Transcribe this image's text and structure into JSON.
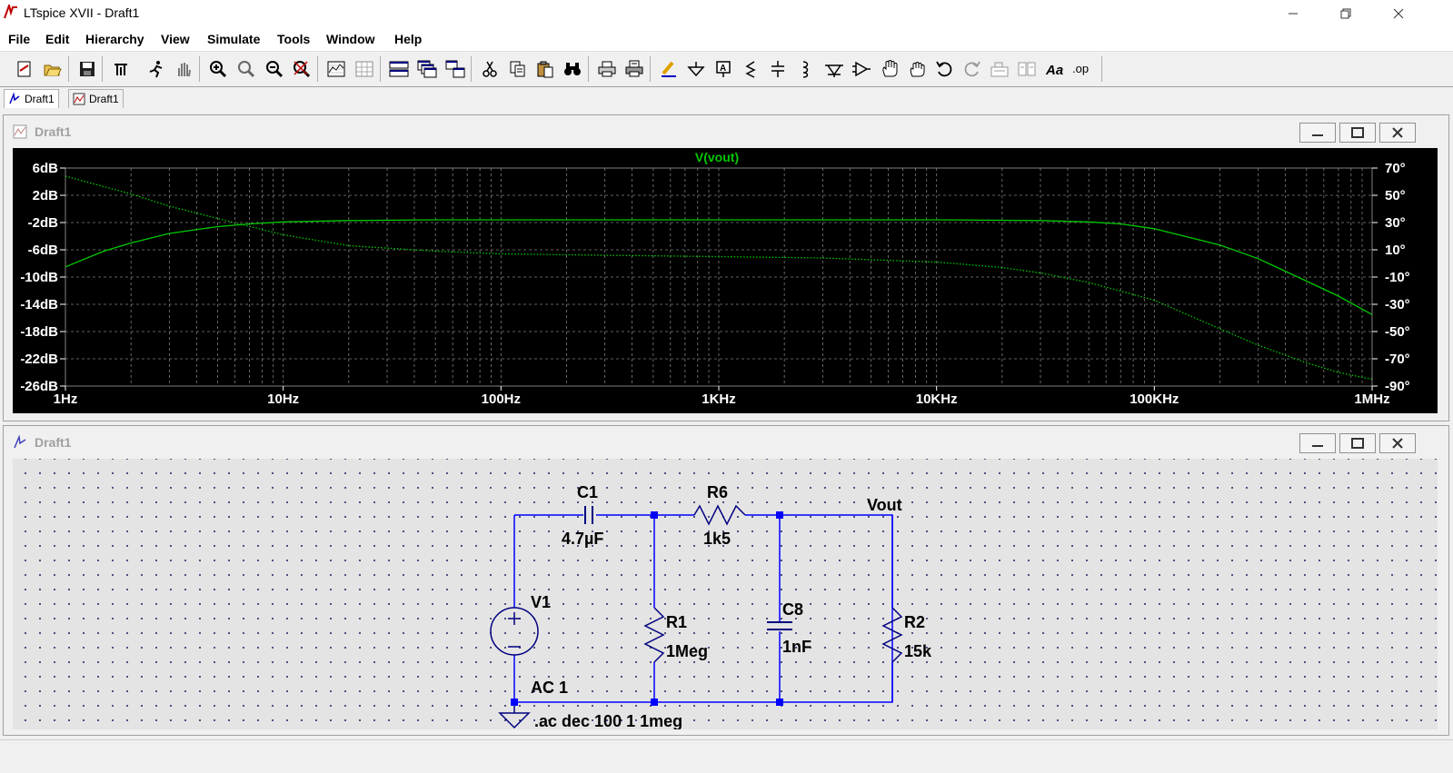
{
  "window": {
    "title": "LTspice XVII - Draft1"
  },
  "menu": {
    "items": [
      "File",
      "Edit",
      "Hierarchy",
      "View",
      "Simulate",
      "Tools",
      "Window",
      "Help"
    ]
  },
  "toolbar": {
    "icons": [
      "new-schematic-icon",
      "open-icon",
      "save-icon",
      "control-panel-icon",
      "run-icon",
      "halt-icon",
      "zoom-in-icon",
      "zoom-pan-icon",
      "zoom-out-icon",
      "zoom-fit-icon",
      "autorange-icon",
      "grid-icon",
      "tile-horizontal-icon",
      "cascade-icon",
      "tile-vertical-icon",
      "cut-icon",
      "copy-icon",
      "paste-icon",
      "find-icon",
      "print-icon",
      "print-preview-icon",
      "wire-icon",
      "ground-icon",
      "label-net-icon",
      "resistor-icon",
      "capacitor-icon",
      "inductor-icon",
      "diode-icon",
      "component-icon",
      "move-icon",
      "drag-icon",
      "undo-icon",
      "redo-icon",
      "rotate-icon",
      "mirror-icon",
      "text-icon",
      "spice-directive-icon"
    ]
  },
  "tabs": [
    {
      "label": "Draft1",
      "icon": "schematic-icon"
    },
    {
      "label": "Draft1",
      "icon": "waveform-icon"
    }
  ],
  "plot_window": {
    "title": "Draft1"
  },
  "schematic_window": {
    "title": "Draft1"
  },
  "colors": {
    "trace": "#00c800",
    "plot_bg": "#000000",
    "grid": "#808080",
    "axis_text": "#ffffff",
    "wire": "#0000ff",
    "component": "#000080",
    "node": "#0000ff"
  },
  "chart_data": {
    "type": "line",
    "title": "V(vout)",
    "x_scale": "log",
    "x_ticks": [
      "1Hz",
      "10Hz",
      "100Hz",
      "1KHz",
      "10KHz",
      "100KHz",
      "1MHz"
    ],
    "xlim": [
      1,
      1000000
    ],
    "y_left_ticks": [
      "6dB",
      "2dB",
      "-2dB",
      "-6dB",
      "-10dB",
      "-14dB",
      "-18dB",
      "-22dB",
      "-26dB"
    ],
    "y_left_lim": [
      -26,
      6
    ],
    "y_right_ticks": [
      "70°",
      "50°",
      "30°",
      "10°",
      "-10°",
      "-30°",
      "-50°",
      "-70°",
      "-90°"
    ],
    "y_right_lim": [
      -90,
      70
    ],
    "grid": true,
    "series": [
      {
        "name": "magnitude",
        "axis": "left",
        "style": "solid",
        "x": [
          1,
          1.5,
          2,
          3,
          5,
          7,
          10,
          20,
          50,
          100,
          1000,
          10000,
          30000,
          50000,
          70000,
          100000,
          200000,
          300000,
          500000,
          700000,
          1000000
        ],
        "y": [
          -8.5,
          -6.2,
          -5.0,
          -3.6,
          -2.6,
          -2.2,
          -1.9,
          -1.7,
          -1.6,
          -1.6,
          -1.6,
          -1.6,
          -1.7,
          -1.9,
          -2.2,
          -2.9,
          -5.3,
          -7.3,
          -10.6,
          -12.8,
          -15.5
        ]
      },
      {
        "name": "phase",
        "axis": "right",
        "style": "dotted",
        "x": [
          1,
          2,
          3,
          5,
          10,
          20,
          50,
          100,
          300,
          1000,
          3000,
          10000,
          20000,
          30000,
          50000,
          100000,
          200000,
          300000,
          500000,
          700000,
          1000000
        ],
        "y": [
          64,
          51,
          42,
          33,
          21,
          13,
          9,
          7,
          6,
          5,
          4,
          1,
          -3,
          -7,
          -14,
          -27,
          -48,
          -60,
          -73,
          -80,
          -85
        ]
      }
    ]
  },
  "schematic": {
    "components": [
      {
        "ref": "C1",
        "value": "4.7µF"
      },
      {
        "ref": "R6",
        "value": "1k5"
      },
      {
        "ref": "R1",
        "value": "1Meg"
      },
      {
        "ref": "C8",
        "value": "1nF"
      },
      {
        "ref": "R2",
        "value": "15k"
      },
      {
        "ref": "V1",
        "value": "AC 1"
      }
    ],
    "net_label": "Vout",
    "directive": ".ac dec 100 1 1meg"
  }
}
